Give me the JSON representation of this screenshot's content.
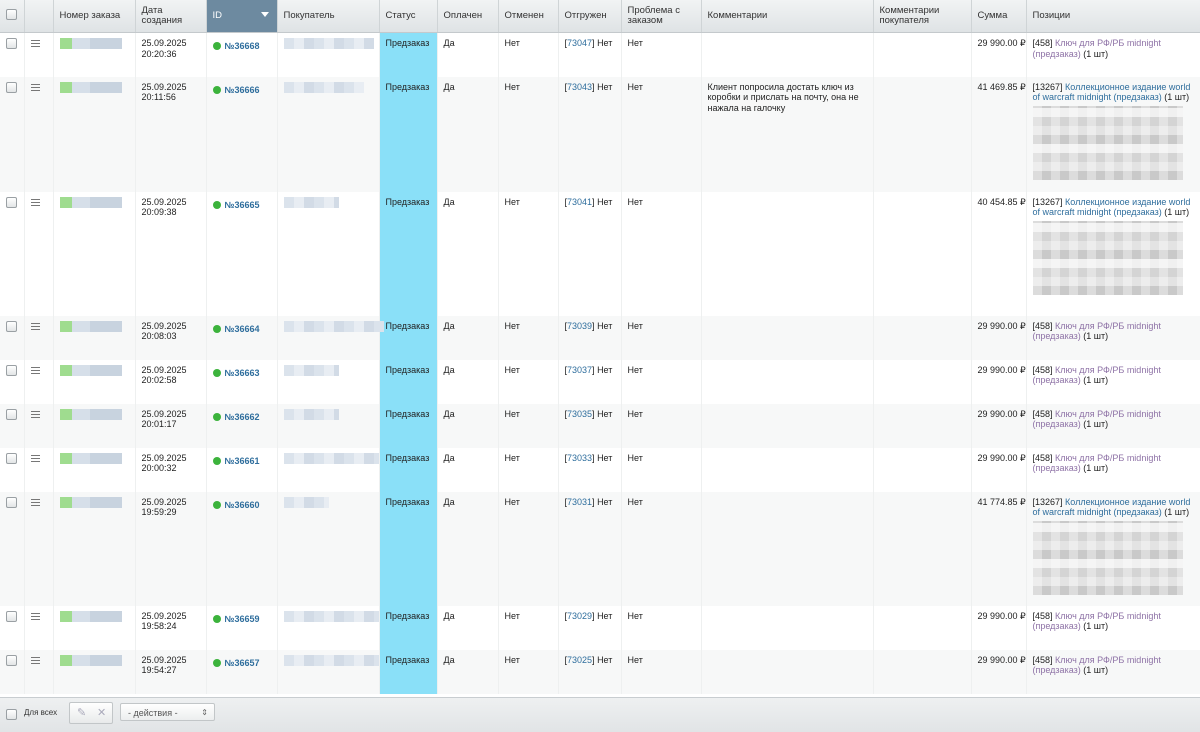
{
  "headers": {
    "order_number": "Номер заказа",
    "created": "Дата создания",
    "id": "ID",
    "buyer": "Покупатель",
    "status": "Статус",
    "paid": "Оплачен",
    "cancelled": "Отменен",
    "shipped": "Отгружен",
    "problem": "Проблема с заказом",
    "comments": "Комментарии",
    "buyer_comments": "Комментарии покупателя",
    "sum": "Сумма",
    "positions": "Позиции"
  },
  "rows": [
    {
      "date": "25.09.2025",
      "time": "20:20:36",
      "id": "№36668",
      "status": "Предзаказ",
      "paid": "Да",
      "cancelled": "Нет",
      "ship_ref": "73047",
      "shipped": "Нет",
      "problem": "Нет",
      "comment": "",
      "sum": "29 990.00 ₽",
      "pos_code": "[458]",
      "pos_name": "Ключ для РФ/РБ midnight (предзаказ)",
      "pos_qty": "(1 шт)"
    },
    {
      "date": "25.09.2025",
      "time": "20:11:56",
      "id": "№36666",
      "status": "Предзаказ",
      "paid": "Да",
      "cancelled": "Нет",
      "ship_ref": "73043",
      "shipped": "Нет",
      "problem": "Нет",
      "comment": "Клиент попросила достать ключ из коробки и прислать на почту, она не нажала на галочку",
      "sum": "41 469.85 ₽",
      "pos_code": "[13267]",
      "pos_name": "Коллекционное издание world of warcraft midnight (предзаказ)",
      "pos_qty": "(1 шт)"
    },
    {
      "date": "25.09.2025",
      "time": "20:09:38",
      "id": "№36665",
      "status": "Предзаказ",
      "paid": "Да",
      "cancelled": "Нет",
      "ship_ref": "73041",
      "shipped": "Нет",
      "problem": "Нет",
      "comment": "",
      "sum": "40 454.85 ₽",
      "pos_code": "[13267]",
      "pos_name": "Коллекционное издание world of warcraft midnight (предзаказ)",
      "pos_qty": "(1 шт)"
    },
    {
      "date": "25.09.2025",
      "time": "20:08:03",
      "id": "№36664",
      "status": "Предзаказ",
      "paid": "Да",
      "cancelled": "Нет",
      "ship_ref": "73039",
      "shipped": "Нет",
      "problem": "Нет",
      "comment": "",
      "sum": "29 990.00 ₽",
      "pos_code": "[458]",
      "pos_name": "Ключ для РФ/РБ midnight (предзаказ)",
      "pos_qty": "(1 шт)"
    },
    {
      "date": "25.09.2025",
      "time": "20:02:58",
      "id": "№36663",
      "status": "Предзаказ",
      "paid": "Да",
      "cancelled": "Нет",
      "ship_ref": "73037",
      "shipped": "Нет",
      "problem": "Нет",
      "comment": "",
      "sum": "29 990.00 ₽",
      "pos_code": "[458]",
      "pos_name": "Ключ для РФ/РБ midnight (предзаказ)",
      "pos_qty": "(1 шт)"
    },
    {
      "date": "25.09.2025",
      "time": "20:01:17",
      "id": "№36662",
      "status": "Предзаказ",
      "paid": "Да",
      "cancelled": "Нет",
      "ship_ref": "73035",
      "shipped": "Нет",
      "problem": "Нет",
      "comment": "",
      "sum": "29 990.00 ₽",
      "pos_code": "[458]",
      "pos_name": "Ключ для РФ/РБ midnight (предзаказ)",
      "pos_qty": "(1 шт)"
    },
    {
      "date": "25.09.2025",
      "time": "20:00:32",
      "id": "№36661",
      "status": "Предзаказ",
      "paid": "Да",
      "cancelled": "Нет",
      "ship_ref": "73033",
      "shipped": "Нет",
      "problem": "Нет",
      "comment": "",
      "sum": "29 990.00 ₽",
      "pos_code": "[458]",
      "pos_name": "Ключ для РФ/РБ midnight (предзаказ)",
      "pos_qty": "(1 шт)"
    },
    {
      "date": "25.09.2025",
      "time": "19:59:29",
      "id": "№36660",
      "status": "Предзаказ",
      "paid": "Да",
      "cancelled": "Нет",
      "ship_ref": "73031",
      "shipped": "Нет",
      "problem": "Нет",
      "comment": "",
      "sum": "41 774.85 ₽",
      "pos_code": "[13267]",
      "pos_name": "Коллекционное издание world of warcraft midnight (предзаказ)",
      "pos_qty": "(1 шт)"
    },
    {
      "date": "25.09.2025",
      "time": "19:58:24",
      "id": "№36659",
      "status": "Предзаказ",
      "paid": "Да",
      "cancelled": "Нет",
      "ship_ref": "73029",
      "shipped": "Нет",
      "problem": "Нет",
      "comment": "",
      "sum": "29 990.00 ₽",
      "pos_code": "[458]",
      "pos_name": "Ключ для РФ/РБ midnight (предзаказ)",
      "pos_qty": "(1 шт)"
    },
    {
      "date": "25.09.2025",
      "time": "19:54:27",
      "id": "№36657",
      "status": "Предзаказ",
      "paid": "Да",
      "cancelled": "Нет",
      "ship_ref": "73025",
      "shipped": "Нет",
      "problem": "Нет",
      "comment": "",
      "sum": "29 990.00 ₽",
      "pos_code": "[458]",
      "pos_name": "Ключ для РФ/РБ midnight (предзаказ)",
      "pos_qty": "(1 шт)"
    }
  ],
  "footer": {
    "for_all": "Для всех",
    "actions_value": "- действия -"
  }
}
